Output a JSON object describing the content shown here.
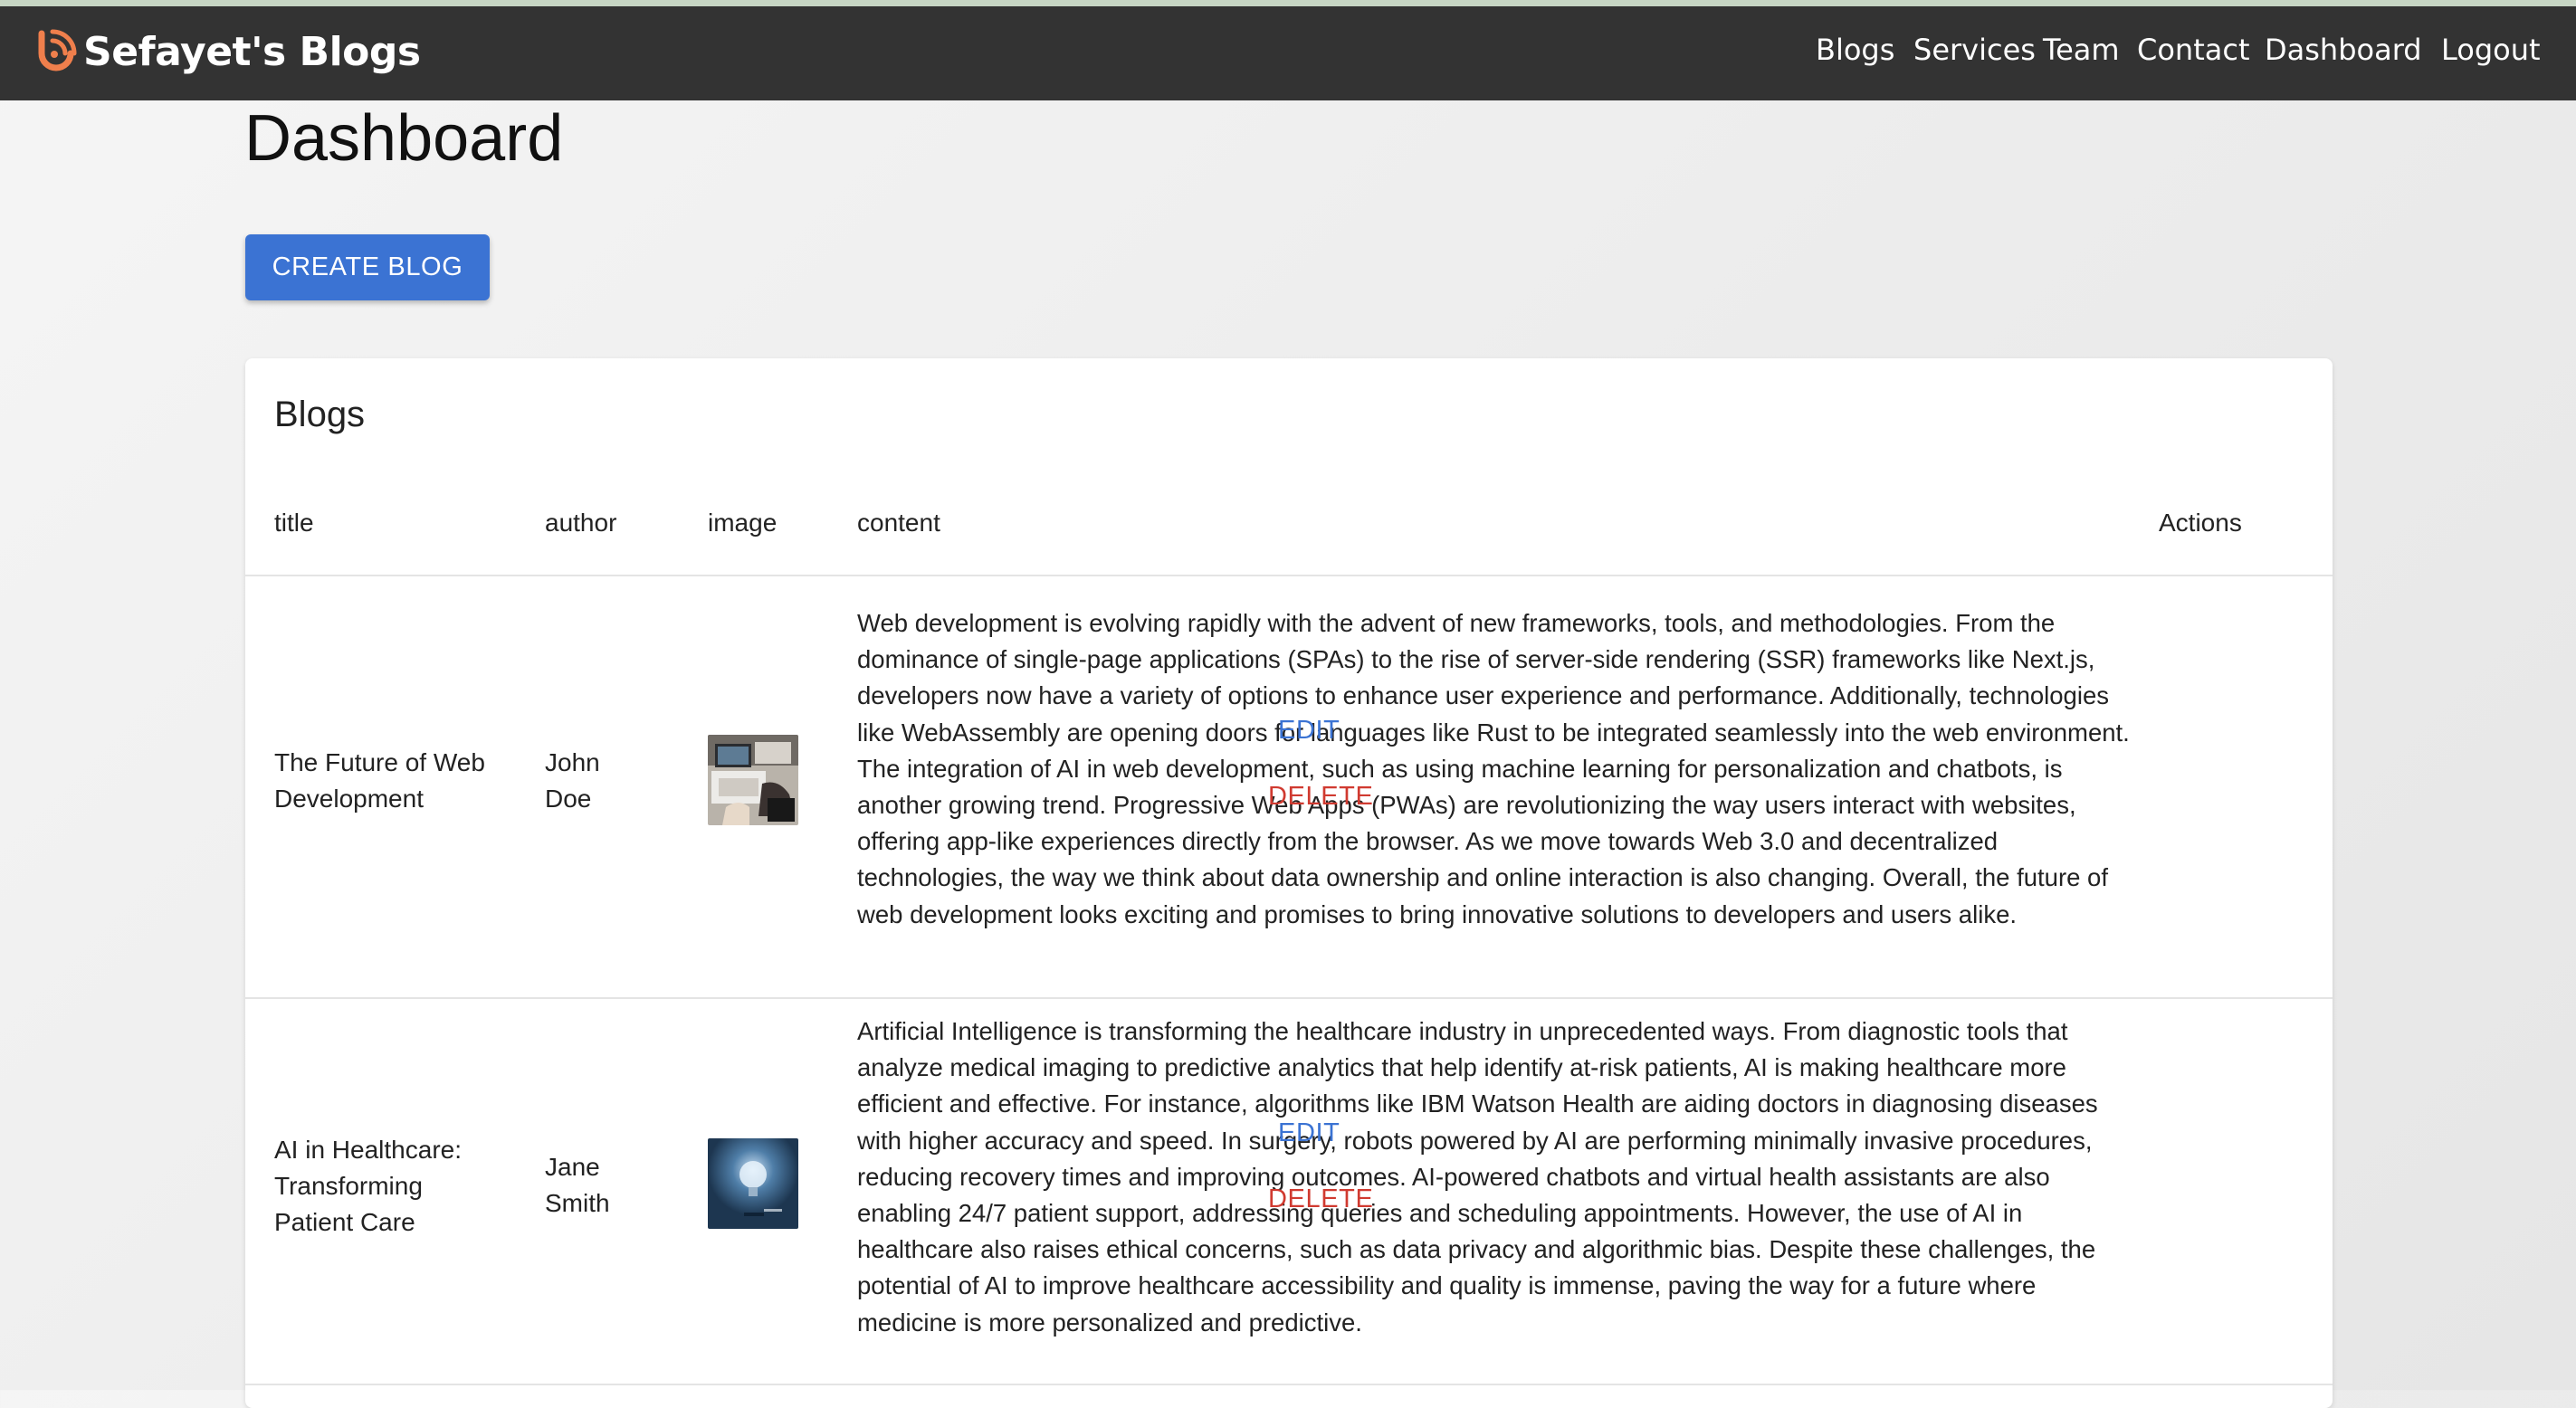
{
  "brand": {
    "name": "Sefayet's Blogs",
    "logo_icon": "rss-feed-icon",
    "accent": "#f07f4c"
  },
  "nav": {
    "blogs": "Blogs",
    "services": "Services",
    "team": "Team",
    "contact": "Contact",
    "dashboard": "Dashboard",
    "logout": "Logout"
  },
  "page": {
    "title": "Dashboard",
    "create_label": "CREATE BLOG"
  },
  "table": {
    "heading": "Blogs",
    "columns": {
      "title": "title",
      "author": "author",
      "image": "image",
      "content": "content",
      "actions": "Actions"
    },
    "rows": [
      {
        "title": "The Future of Web Development",
        "author": "John Doe",
        "image_icon": "laptop-workspace-thumbnail",
        "content": "Web development is evolving rapidly with the advent of new frameworks, tools, and methodologies. From the dominance of single-page applications (SPAs) to the rise of server-side rendering (SSR) frameworks like Next.js, developers now have a variety of options to enhance user experience and performance. Additionally, technologies like WebAssembly are opening doors for languages like Rust to be integrated seamlessly into the web environment. The integration of AI in web development, such as using machine learning for personalization and chatbots, is another growing trend. Progressive Web Apps (PWAs) are revolutionizing the way users interact with websites, offering app-like experiences directly from the browser. As we move towards Web 3.0 and decentralized technologies, the way we think about data ownership and online interaction is also changing. Overall, the future of web development looks exciting and promises to bring innovative solutions to developers and users alike.",
        "edit": "EDIT",
        "delete": "DELETE"
      },
      {
        "title": "AI in Healthcare: Transforming Patient Care",
        "author": "Jane Smith",
        "image_icon": "lightbulb-thumbnail",
        "content": "Artificial Intelligence is transforming the healthcare industry in unprecedented ways. From diagnostic tools that analyze medical imaging to predictive analytics that help identify at-risk patients, AI is making healthcare more efficient and effective. For instance, algorithms like IBM Watson Health are aiding doctors in diagnosing diseases with higher accuracy and speed. In surgery, robots powered by AI are performing minimally invasive procedures, reducing recovery times and improving outcomes. AI-powered chatbots and virtual health assistants are also enabling 24/7 patient support, addressing queries and scheduling appointments. However, the use of AI in healthcare also raises ethical concerns, such as data privacy and algorithmic bias. Despite these challenges, the potential of AI to improve healthcare accessibility and quality is immense, paving the way for a future where medicine is more personalized and predictive.",
        "edit": "EDIT",
        "delete": "DELETE"
      }
    ]
  },
  "colors": {
    "navbar": "#333333",
    "primary": "#3b73d3",
    "danger": "#d03a30"
  }
}
